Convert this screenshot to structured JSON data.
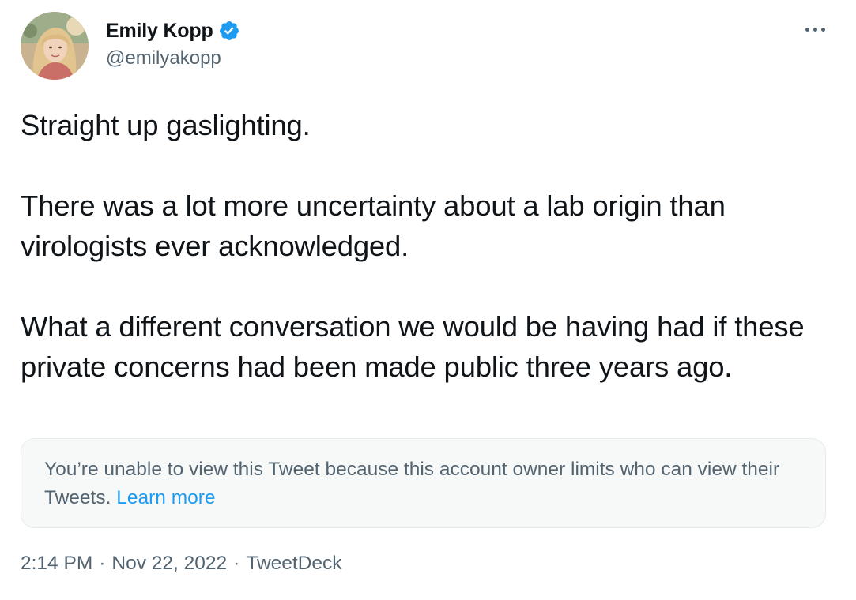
{
  "author": {
    "display_name": "Emily Kopp",
    "handle": "@emilyakopp",
    "verified": true,
    "avatar": "profile-photo"
  },
  "more_icon": "more-options-icon",
  "tweet": {
    "paragraphs": [
      "Straight up gaslighting.",
      "There was a lot more uncertainty about a lab origin than virologists ever acknowledged.",
      "What a different conversation we would be having had if these private concerns had been made public three years ago."
    ]
  },
  "quoted_notice": {
    "text": "You’re unable to view this Tweet because this account owner limits who can view their Tweets.",
    "link_label": "Learn more"
  },
  "meta": {
    "time": "2:14 PM",
    "separator": "·",
    "date": "Nov 22, 2022",
    "source": "TweetDeck"
  },
  "colors": {
    "text_primary": "#0f1419",
    "text_secondary": "#536471",
    "link": "#1d9bf0",
    "verified_badge": "#1d9bf0",
    "notice_background": "#f7f9f9"
  }
}
